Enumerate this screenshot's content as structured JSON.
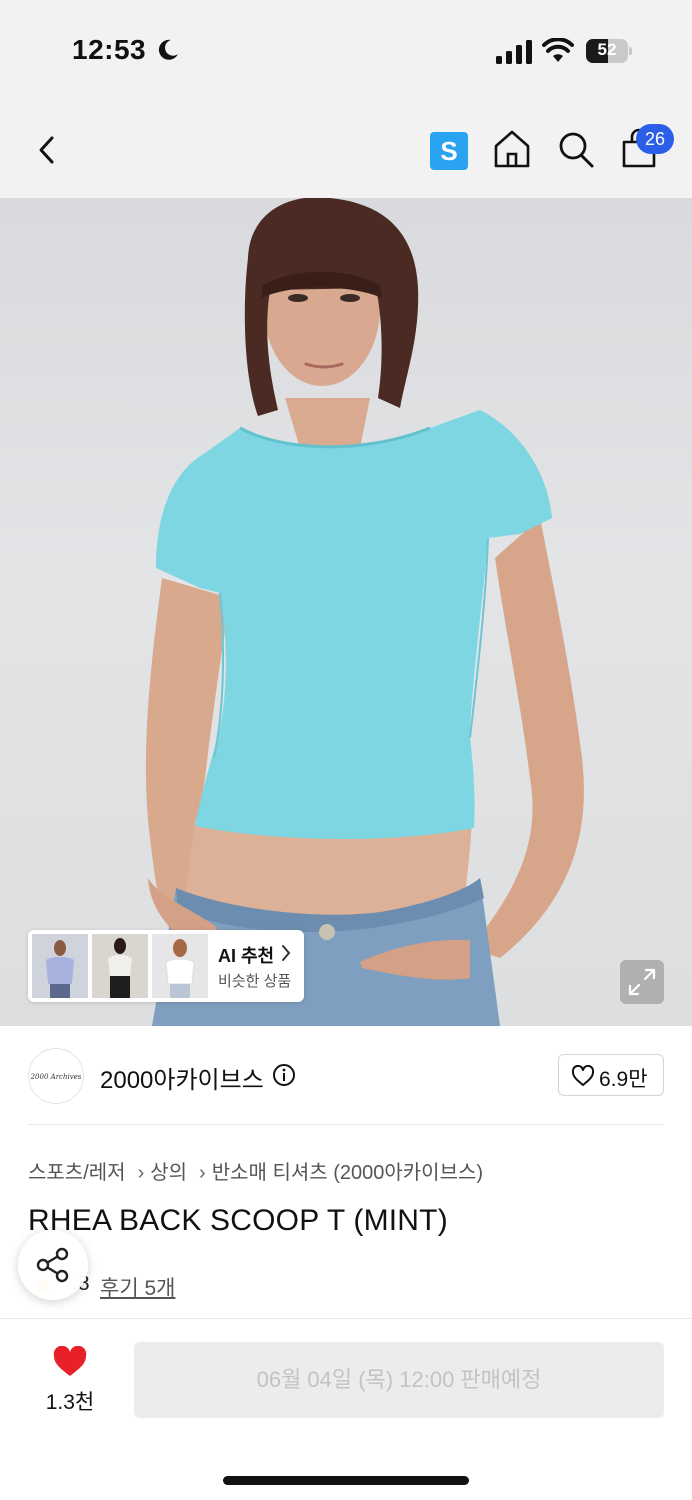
{
  "status_bar": {
    "time": "12:53",
    "battery": "52",
    "battery_level": 0.52,
    "icons": [
      "moon-icon",
      "signal-icon",
      "wifi-icon",
      "battery-icon"
    ]
  },
  "nav": {
    "back_icon": "chevron-left-icon",
    "s_badge": "S",
    "home_icon": "home-icon",
    "search_icon": "search-icon",
    "cart_icon": "shopping-bag-icon",
    "cart_count": "26"
  },
  "hero": {
    "ai_recommend": {
      "title": "AI 추천",
      "subtitle": "비슷한 상품"
    },
    "expand_icon": "expand-icon"
  },
  "brand": {
    "logo_text": "2000 Archives",
    "name": "2000아카이브스",
    "likes": "6.9만"
  },
  "breadcrumb": [
    "스포츠/레저",
    "상의",
    "반소매 티셔츠 (2000아카이브스)"
  ],
  "product": {
    "title": "RHEA BACK SCOOP T (MINT)",
    "rating": ".8",
    "reviews": "후기 5개"
  },
  "bottom_bar": {
    "wish_count": "1.3천",
    "cta_label": "06월 04일 (목) 12:00 판매예정"
  },
  "colors": {
    "accent_blue": "#2b5fe8",
    "s_badge": "#2aa4f0",
    "wish_red": "#e8202a",
    "shirt_mint": "#7fd6e3",
    "disabled_bg": "#ececec",
    "disabled_text": "#c3c3c3"
  }
}
